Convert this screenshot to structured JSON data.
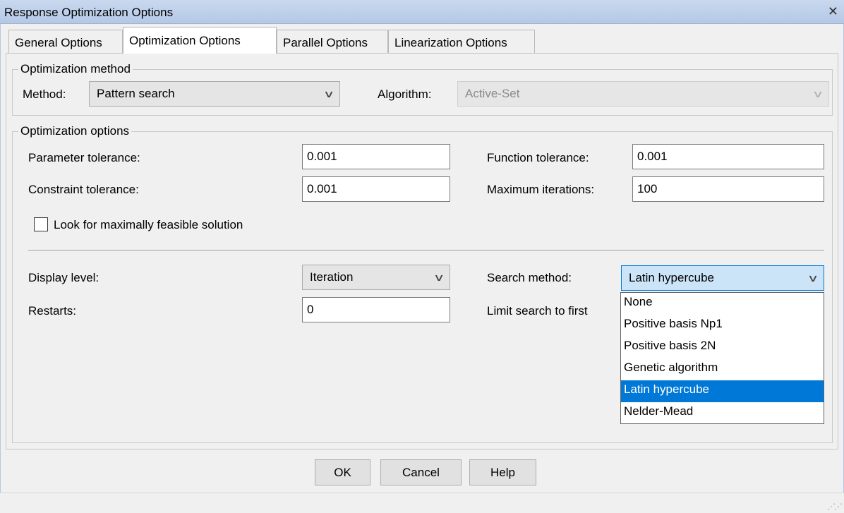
{
  "window": {
    "title": "Response Optimization Options",
    "close_glyph": "✕"
  },
  "tabs": [
    {
      "label": "General Options",
      "active": false
    },
    {
      "label": "Optimization Options",
      "active": true
    },
    {
      "label": "Parallel Options",
      "active": false
    },
    {
      "label": "Linearization Options",
      "active": false
    }
  ],
  "method_group": {
    "title": "Optimization method",
    "method_label": "Method:",
    "method_value": "Pattern search",
    "algorithm_label": "Algorithm:",
    "algorithm_value": "Active-Set"
  },
  "options_group": {
    "title": "Optimization options",
    "parameter_tolerance_label": "Parameter tolerance:",
    "parameter_tolerance_value": "0.001",
    "function_tolerance_label": "Function tolerance:",
    "function_tolerance_value": "0.001",
    "constraint_tolerance_label": "Constraint tolerance:",
    "constraint_tolerance_value": "0.001",
    "maximum_iterations_label": "Maximum iterations:",
    "maximum_iterations_value": "100",
    "feasible_checkbox_label": "Look for maximally feasible solution",
    "feasible_checked": false,
    "display_level_label": "Display level:",
    "display_level_value": "Iteration",
    "search_method_label": "Search method:",
    "search_method_value": "Latin hypercube",
    "restarts_label": "Restarts:",
    "restarts_value": "0",
    "limit_search_label": "Limit search to first"
  },
  "search_method_dropdown": {
    "options": [
      "None",
      "Positive basis Np1",
      "Positive basis 2N",
      "Genetic algorithm",
      "Latin hypercube",
      "Nelder-Mead"
    ],
    "selected": "Latin hypercube"
  },
  "buttons": {
    "ok": "OK",
    "cancel": "Cancel",
    "help": "Help"
  },
  "colors": {
    "selection": "#0078d7",
    "focused_combo": "#cce4f7",
    "titlebar": "#b4c8e6"
  }
}
